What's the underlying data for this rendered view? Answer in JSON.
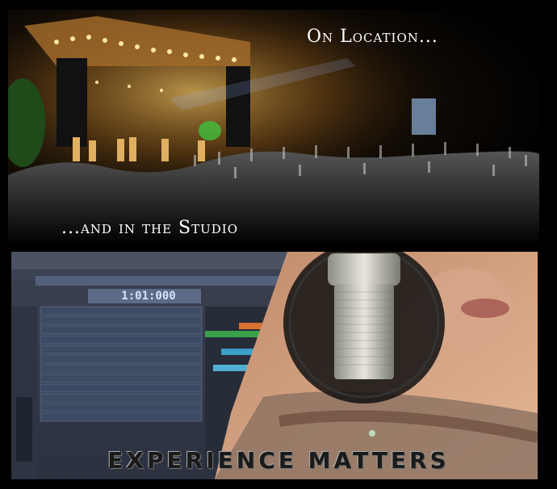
{
  "banner": {
    "top_caption": "On Location...",
    "middle_caption": "...and in the Studio",
    "tagline": "EXPERIENCE MATTERS",
    "daw_timecode": "1:01:000"
  }
}
